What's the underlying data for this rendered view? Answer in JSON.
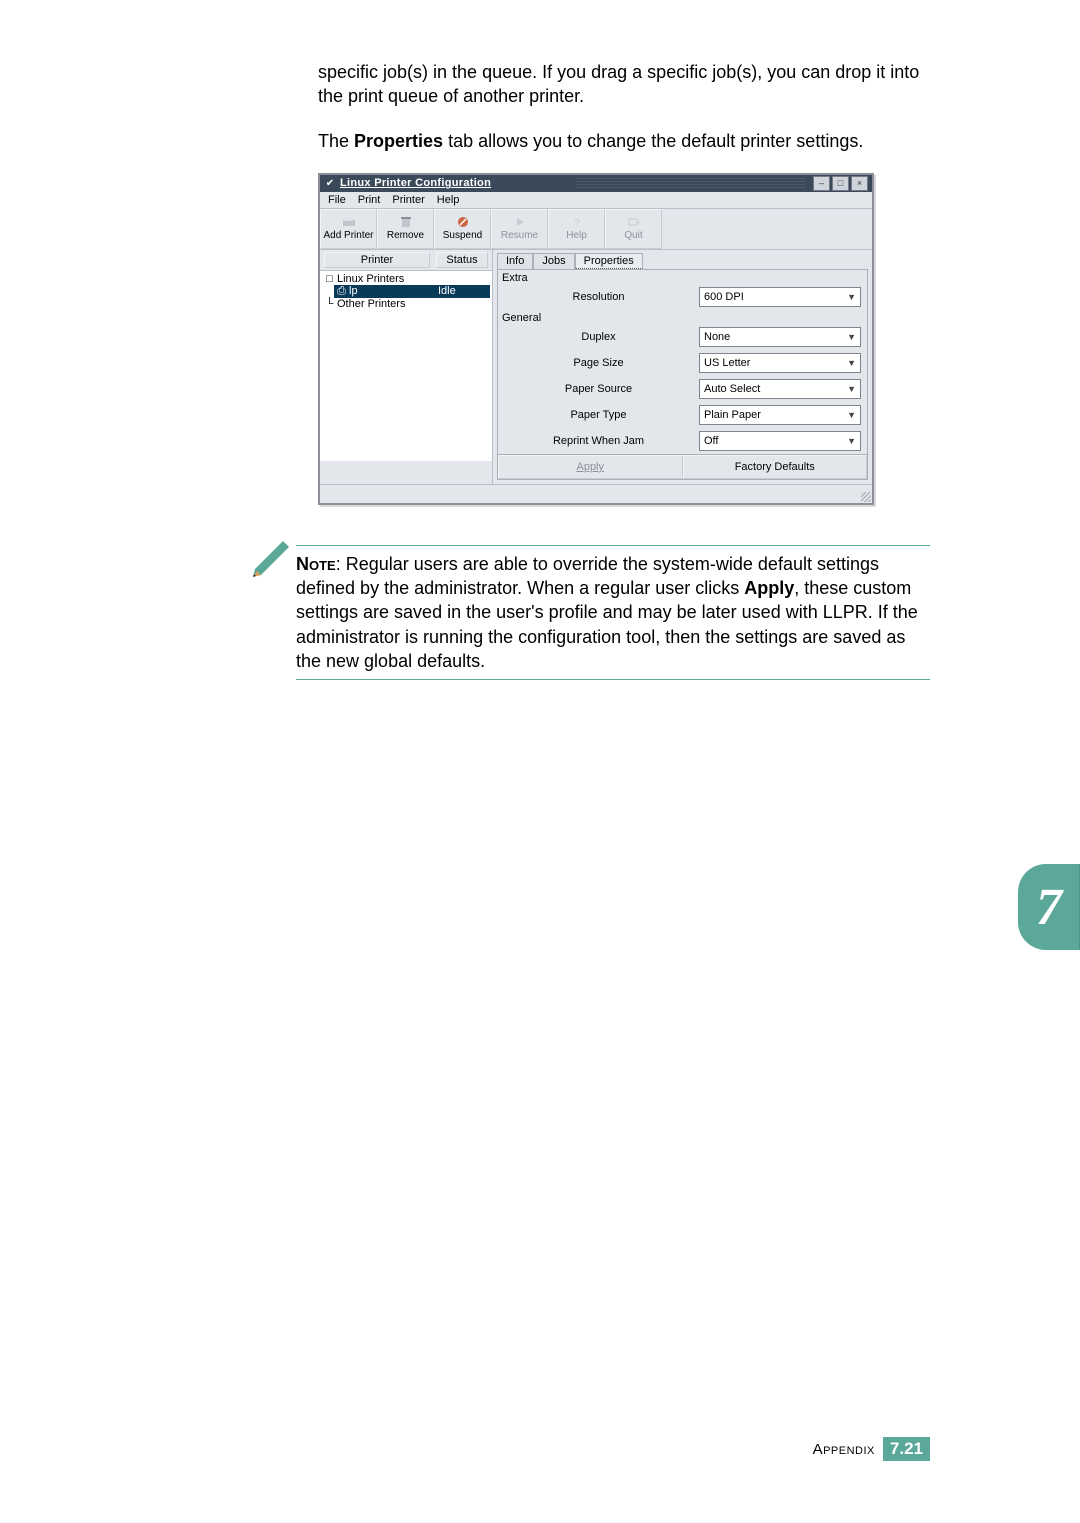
{
  "intro": {
    "p1": "specific job(s) in the queue. If you drag a specific job(s), you can drop it into the print queue of another printer.",
    "p2_a": "The ",
    "p2_b": "Properties",
    "p2_c": " tab allows you to change the default printer settings."
  },
  "window": {
    "title": "Linux Printer Configuration",
    "controls": {
      "min": "–",
      "max": "□",
      "close": "×"
    },
    "menubar": [
      "File",
      "Print",
      "Printer",
      "Help"
    ],
    "toolbar": [
      {
        "label": "Add Printer",
        "enabled": true,
        "name": "add-printer-button"
      },
      {
        "label": "Remove",
        "enabled": true,
        "name": "remove-button"
      },
      {
        "label": "Suspend",
        "enabled": true,
        "name": "suspend-button"
      },
      {
        "label": "Resume",
        "enabled": false,
        "name": "resume-button"
      },
      {
        "label": "Help",
        "enabled": false,
        "name": "help-button"
      },
      {
        "label": "Quit",
        "enabled": false,
        "name": "quit-button"
      }
    ],
    "printer_list": {
      "header": {
        "col1": "Printer",
        "col2": "Status"
      },
      "rows": [
        {
          "label": "Linux Printers",
          "status": "",
          "sel": false,
          "icon": "□"
        },
        {
          "label": "lp",
          "status": "Idle",
          "sel": true,
          "icon": "⎙"
        },
        {
          "label": "Other Printers",
          "status": "",
          "sel": false,
          "icon": ""
        }
      ]
    },
    "tabs": [
      "Info",
      "Jobs",
      "Properties"
    ],
    "active_tab": "Properties",
    "groups": {
      "extra": {
        "title": "Extra",
        "rows": [
          {
            "label": "Resolution",
            "value": "600 DPI"
          }
        ]
      },
      "general": {
        "title": "General",
        "rows": [
          {
            "label": "Duplex",
            "value": "None"
          },
          {
            "label": "Page Size",
            "value": "US Letter"
          },
          {
            "label": "Paper Source",
            "value": "Auto Select"
          },
          {
            "label": "Paper Type",
            "value": "Plain Paper"
          },
          {
            "label": "Reprint When Jam",
            "value": "Off"
          }
        ]
      }
    },
    "buttons": {
      "apply": "Apply",
      "defaults": "Factory Defaults"
    }
  },
  "note": {
    "lead": "Note",
    "body_a": ": Regular users are able to override the system-wide default settings defined by the administrator. When a regular user clicks ",
    "body_b": "Apply",
    "body_c": ", these custom settings are saved in the user's profile and may be later used with LLPR. If the administrator is running the configuration tool, then the settings are saved as the new global defaults."
  },
  "sidetab": "7",
  "footer": {
    "label": "Appendix",
    "chapter": "7",
    "sep": ".",
    "page": "21"
  }
}
